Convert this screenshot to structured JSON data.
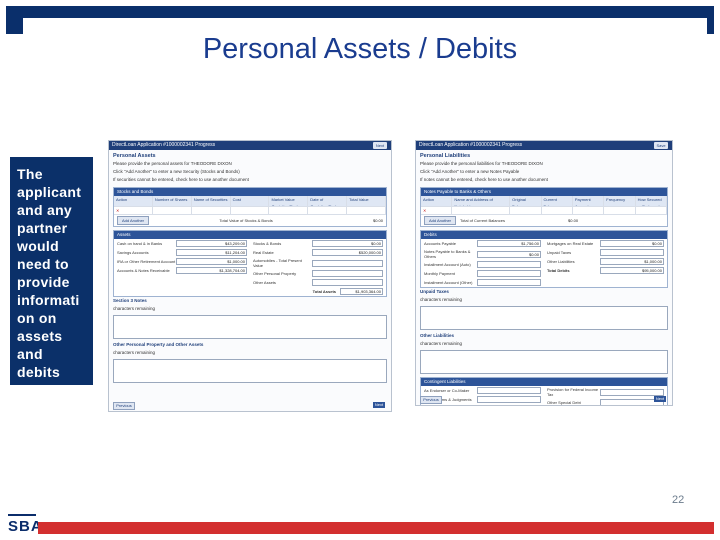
{
  "slide": {
    "title": "Personal Assets / Debits",
    "sidebar_text": "The applicant and any partner would need to provide information on assets and debits",
    "page_number": "22",
    "logo_text": "SBA"
  },
  "colors": {
    "navy": "#0a2f6b",
    "title_blue": "#1a3c8f",
    "red_bar": "#d32f2f"
  },
  "left_screenshot": {
    "title_bar": "DirectLoan Application #1000002341 Progress",
    "header_button": "Next",
    "heading": "Personal Assets",
    "intro": "Please provide the personal assets for THEODORE DIXON",
    "option1": "Click \"Add Another\" to enter a new Security (Stocks and Bonds)",
    "option2": "If securities cannot be entered, check here to use another document",
    "section1": "Stocks and Bonds",
    "columns": [
      "Action",
      "Number of Shares",
      "Name of Securities",
      "Cost",
      "Market Value Quotation/Exchange",
      "Date of Quotation/Exchange",
      "Total Value"
    ],
    "add_button": "Add Another",
    "total_label": "Total Value of Stocks & Bonds",
    "total_value": "$0.00",
    "assets_section": "Assets",
    "asset_rows": [
      {
        "label": "Cash on hand & in Banks",
        "value": "$43,209.00"
      },
      {
        "label": "Savings Accounts",
        "value": "$11,204.00"
      },
      {
        "label": "IRA or Other Retirement Account",
        "value": "$1,000.00"
      },
      {
        "label": "Accounts & Notes Receivable",
        "value": "$1,328,704.00"
      }
    ],
    "asset_rows_right": [
      {
        "label": "Stocks & Bonds",
        "value": "$0.00"
      },
      {
        "label": "Real Estate",
        "value": "$520,000.00"
      },
      {
        "label": "Automobiles - Total Present Value",
        "value": ""
      },
      {
        "label": "Other Personal Property",
        "value": ""
      },
      {
        "label": "Other Assets",
        "value": ""
      }
    ],
    "total_assets_label": "Total Assets",
    "total_assets_value": "$1,903,364.00",
    "section_notes": "Section 3 Notes",
    "chars_remaining": "characters remaining",
    "section_other": "Other Personal Property and Other Assets",
    "footer_button": "Previous",
    "footer_next": "Next"
  },
  "right_screenshot": {
    "title_bar": "DirectLoan Application #1000002341 Progress",
    "header_button": "Save",
    "heading": "Personal Liabilities",
    "intro": "Please provide the personal liabilities for THEODORE DIXON",
    "option1": "Click \"Add Another\" to enter a new Notes Payable",
    "option2": "If notes cannot be entered, check here to use another document",
    "section1": "Notes Payable to Banks & Others",
    "columns": [
      "Action",
      "Name and Address of Noteholder",
      "Original Balance",
      "Current Balance",
      "Payment Amount",
      "Frequency",
      "How Secured or Endorsed"
    ],
    "add_button": "Add Another",
    "total_label": "Total of Current Balances",
    "total_value": "$0.00",
    "debits_section": "Debits",
    "debit_rows": [
      {
        "label": "Accounts Payable",
        "value": "$1,756.00"
      },
      {
        "label": "Notes Payable to Banks & Others",
        "value": "$0.00"
      },
      {
        "label": "Installment Account (Auto)",
        "value": ""
      },
      {
        "label": "Monthly Payment",
        "value": ""
      },
      {
        "label": "Installment Account (Other)",
        "value": ""
      }
    ],
    "debit_rows_right": [
      {
        "label": "Mortgages on Real Estate",
        "value": "$0.00"
      },
      {
        "label": "Unpaid Taxes",
        "value": ""
      },
      {
        "label": "Other Liabilities",
        "value": "$1,000.00"
      },
      {
        "label": "Total Debits",
        "value": "$95,000.00"
      }
    ],
    "unpaid_taxes": "Unpaid Taxes",
    "chars_remaining": "characters remaining",
    "other_section": "Other Liabilities",
    "contingent_section": "Contingent Liabilities",
    "contingent_rows": [
      {
        "label": "As Endorser or Co-Maker",
        "value": ""
      },
      {
        "label": "Provision for Federal Income Tax",
        "value": ""
      },
      {
        "label": "Legal Claims & Judgments",
        "value": ""
      },
      {
        "label": "Other Special Debt",
        "value": ""
      }
    ],
    "footer_button": "Previous",
    "footer_next": "Next"
  }
}
